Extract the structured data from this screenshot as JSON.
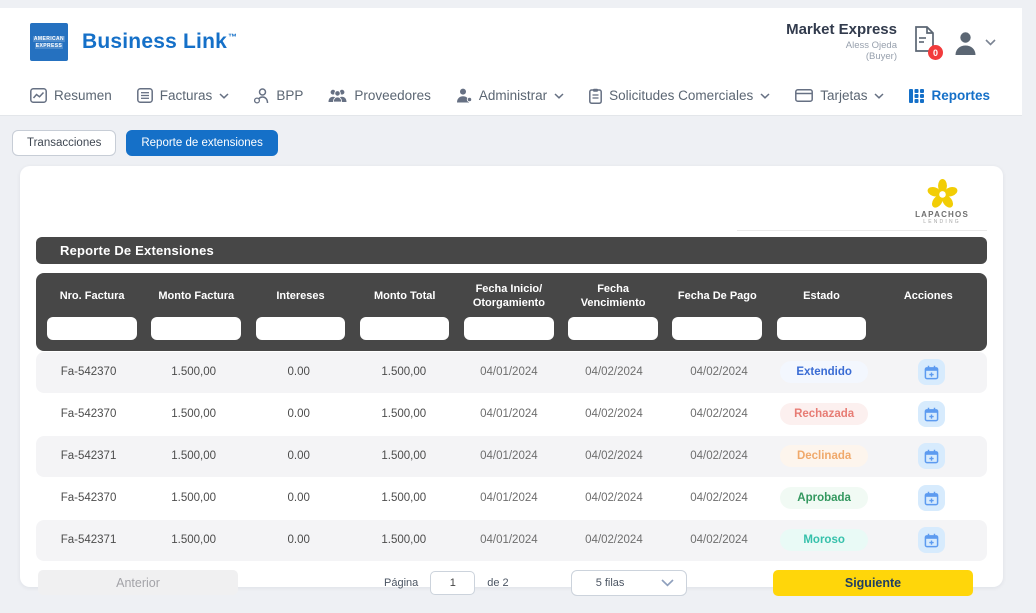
{
  "header": {
    "brand": "Business Link",
    "brand_tm": "™",
    "logo_line1": "AMERICAN",
    "logo_line2": "EXPRESS",
    "account_name": "Market Express",
    "user_name": "Aless Ojeda",
    "user_role": "(Buyer)",
    "notification_count": "0"
  },
  "nav": {
    "items": [
      {
        "label": "Resumen",
        "icon": "chart-icon",
        "dropdown": false,
        "active": false
      },
      {
        "label": "Facturas",
        "icon": "list-icon",
        "dropdown": true,
        "active": false
      },
      {
        "label": "BPP",
        "icon": "person-badge-icon",
        "dropdown": false,
        "active": false
      },
      {
        "label": "Proveedores",
        "icon": "people-icon",
        "dropdown": false,
        "active": false
      },
      {
        "label": "Administrar",
        "icon": "person-icon",
        "dropdown": true,
        "active": false
      },
      {
        "label": "Solicitudes Comerciales",
        "icon": "clipboard-icon",
        "dropdown": true,
        "active": false
      },
      {
        "label": "Tarjetas",
        "icon": "card-icon",
        "dropdown": true,
        "active": false
      },
      {
        "label": "Reportes",
        "icon": "grid-icon",
        "dropdown": false,
        "active": true
      }
    ]
  },
  "tabs": [
    {
      "label": "Transacciones",
      "active": false
    },
    {
      "label": "Reporte de extensiones",
      "active": true
    }
  ],
  "card": {
    "logo_title": "LAPACHOS",
    "logo_subtitle": "LENDING",
    "title": "Reporte De Extensiones"
  },
  "table": {
    "columns": [
      "Nro. Factura",
      "Monto Factura",
      "Intereses",
      "Monto Total",
      "Fecha Inicio/ Otorgamiento",
      "Fecha Vencimiento",
      "Fecha De Pago",
      "Estado",
      "Acciones"
    ],
    "rows": [
      {
        "nro": "Fa-542370",
        "monto": "1.500,00",
        "intereses": "0.00",
        "total": "1.500,00",
        "inicio": "04/01/2024",
        "vencimiento": "04/02/2024",
        "pago": "04/02/2024",
        "estado": "Extendido",
        "estado_type": "extendido"
      },
      {
        "nro": "Fa-542370",
        "monto": "1.500,00",
        "intereses": "0.00",
        "total": "1.500,00",
        "inicio": "04/01/2024",
        "vencimiento": "04/02/2024",
        "pago": "04/02/2024",
        "estado": "Rechazada",
        "estado_type": "rechazada"
      },
      {
        "nro": "Fa-542371",
        "monto": "1.500,00",
        "intereses": "0.00",
        "total": "1.500,00",
        "inicio": "04/01/2024",
        "vencimiento": "04/02/2024",
        "pago": "04/02/2024",
        "estado": "Declinada",
        "estado_type": "declinada"
      },
      {
        "nro": "Fa-542370",
        "monto": "1.500,00",
        "intereses": "0.00",
        "total": "1.500,00",
        "inicio": "04/01/2024",
        "vencimiento": "04/02/2024",
        "pago": "04/02/2024",
        "estado": "Aprobada",
        "estado_type": "aprobada"
      },
      {
        "nro": "Fa-542371",
        "monto": "1.500,00",
        "intereses": "0.00",
        "total": "1.500,00",
        "inicio": "04/01/2024",
        "vencimiento": "04/02/2024",
        "pago": "04/02/2024",
        "estado": "Moroso",
        "estado_type": "moroso"
      }
    ]
  },
  "pagination": {
    "prev_label": "Anterior",
    "page_label": "Página",
    "page_value": "1",
    "of_label": "de 2",
    "rows_select_value": "5 filas",
    "next_label": "Siguiente"
  },
  "colors": {
    "accent_blue": "#1570c8",
    "brand_blue": "#2571c0",
    "header_dark": "#474747",
    "next_yellow": "#ffd60a",
    "notification_red": "#f23b3c",
    "badge_extendido": "#3a6cd4",
    "badge_rechazada": "#e77c74",
    "badge_declinada": "#f0a96b",
    "badge_aprobada": "#33985f",
    "badge_moroso": "#36c1ab"
  }
}
